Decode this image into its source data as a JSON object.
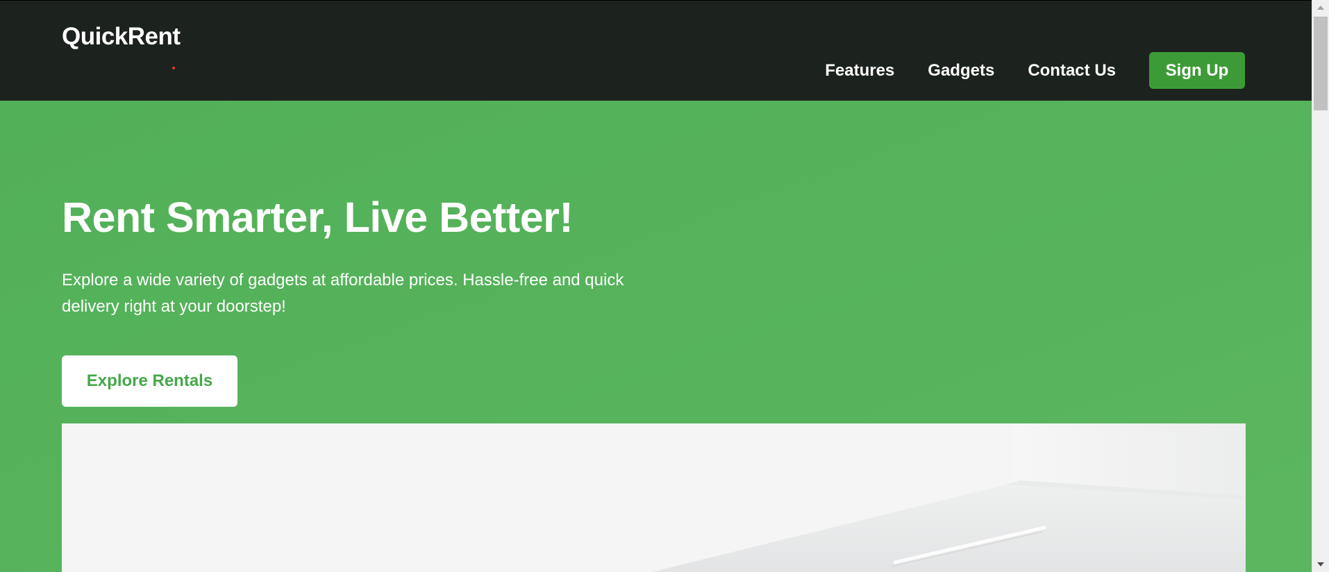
{
  "brand": {
    "name": "QuickRent",
    "accent": "#4caf50",
    "nav_bg": "#1c221e",
    "dot_color": "#e53935"
  },
  "nav": {
    "links": [
      "Features",
      "Gadgets",
      "Contact Us"
    ],
    "signup_label": "Sign Up"
  },
  "hero": {
    "title": "Rent Smarter, Live Better!",
    "description": "Explore a wide variety of gadgets at affordable prices. Hassle-free and quick delivery right at your doorstep!",
    "cta_label": "Explore Rentals"
  },
  "icons": {
    "scroll_up": "triangle-up",
    "scroll_down": "triangle-down"
  }
}
